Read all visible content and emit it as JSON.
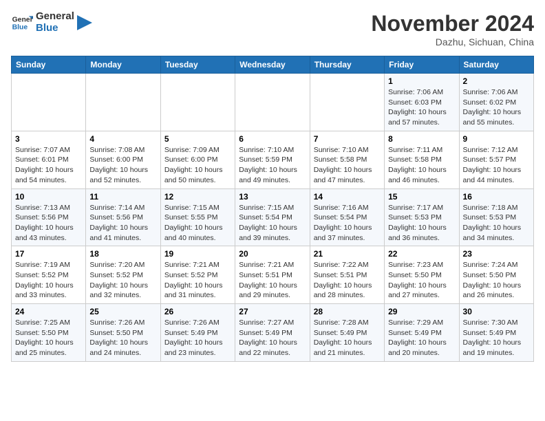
{
  "header": {
    "logo_line1": "General",
    "logo_line2": "Blue",
    "month": "November 2024",
    "location": "Dazhu, Sichuan, China"
  },
  "weekdays": [
    "Sunday",
    "Monday",
    "Tuesday",
    "Wednesday",
    "Thursday",
    "Friday",
    "Saturday"
  ],
  "weeks": [
    [
      {
        "day": "",
        "info": ""
      },
      {
        "day": "",
        "info": ""
      },
      {
        "day": "",
        "info": ""
      },
      {
        "day": "",
        "info": ""
      },
      {
        "day": "",
        "info": ""
      },
      {
        "day": "1",
        "info": "Sunrise: 7:06 AM\nSunset: 6:03 PM\nDaylight: 10 hours and 57 minutes."
      },
      {
        "day": "2",
        "info": "Sunrise: 7:06 AM\nSunset: 6:02 PM\nDaylight: 10 hours and 55 minutes."
      }
    ],
    [
      {
        "day": "3",
        "info": "Sunrise: 7:07 AM\nSunset: 6:01 PM\nDaylight: 10 hours and 54 minutes."
      },
      {
        "day": "4",
        "info": "Sunrise: 7:08 AM\nSunset: 6:00 PM\nDaylight: 10 hours and 52 minutes."
      },
      {
        "day": "5",
        "info": "Sunrise: 7:09 AM\nSunset: 6:00 PM\nDaylight: 10 hours and 50 minutes."
      },
      {
        "day": "6",
        "info": "Sunrise: 7:10 AM\nSunset: 5:59 PM\nDaylight: 10 hours and 49 minutes."
      },
      {
        "day": "7",
        "info": "Sunrise: 7:10 AM\nSunset: 5:58 PM\nDaylight: 10 hours and 47 minutes."
      },
      {
        "day": "8",
        "info": "Sunrise: 7:11 AM\nSunset: 5:58 PM\nDaylight: 10 hours and 46 minutes."
      },
      {
        "day": "9",
        "info": "Sunrise: 7:12 AM\nSunset: 5:57 PM\nDaylight: 10 hours and 44 minutes."
      }
    ],
    [
      {
        "day": "10",
        "info": "Sunrise: 7:13 AM\nSunset: 5:56 PM\nDaylight: 10 hours and 43 minutes."
      },
      {
        "day": "11",
        "info": "Sunrise: 7:14 AM\nSunset: 5:56 PM\nDaylight: 10 hours and 41 minutes."
      },
      {
        "day": "12",
        "info": "Sunrise: 7:15 AM\nSunset: 5:55 PM\nDaylight: 10 hours and 40 minutes."
      },
      {
        "day": "13",
        "info": "Sunrise: 7:15 AM\nSunset: 5:54 PM\nDaylight: 10 hours and 39 minutes."
      },
      {
        "day": "14",
        "info": "Sunrise: 7:16 AM\nSunset: 5:54 PM\nDaylight: 10 hours and 37 minutes."
      },
      {
        "day": "15",
        "info": "Sunrise: 7:17 AM\nSunset: 5:53 PM\nDaylight: 10 hours and 36 minutes."
      },
      {
        "day": "16",
        "info": "Sunrise: 7:18 AM\nSunset: 5:53 PM\nDaylight: 10 hours and 34 minutes."
      }
    ],
    [
      {
        "day": "17",
        "info": "Sunrise: 7:19 AM\nSunset: 5:52 PM\nDaylight: 10 hours and 33 minutes."
      },
      {
        "day": "18",
        "info": "Sunrise: 7:20 AM\nSunset: 5:52 PM\nDaylight: 10 hours and 32 minutes."
      },
      {
        "day": "19",
        "info": "Sunrise: 7:21 AM\nSunset: 5:52 PM\nDaylight: 10 hours and 31 minutes."
      },
      {
        "day": "20",
        "info": "Sunrise: 7:21 AM\nSunset: 5:51 PM\nDaylight: 10 hours and 29 minutes."
      },
      {
        "day": "21",
        "info": "Sunrise: 7:22 AM\nSunset: 5:51 PM\nDaylight: 10 hours and 28 minutes."
      },
      {
        "day": "22",
        "info": "Sunrise: 7:23 AM\nSunset: 5:50 PM\nDaylight: 10 hours and 27 minutes."
      },
      {
        "day": "23",
        "info": "Sunrise: 7:24 AM\nSunset: 5:50 PM\nDaylight: 10 hours and 26 minutes."
      }
    ],
    [
      {
        "day": "24",
        "info": "Sunrise: 7:25 AM\nSunset: 5:50 PM\nDaylight: 10 hours and 25 minutes."
      },
      {
        "day": "25",
        "info": "Sunrise: 7:26 AM\nSunset: 5:50 PM\nDaylight: 10 hours and 24 minutes."
      },
      {
        "day": "26",
        "info": "Sunrise: 7:26 AM\nSunset: 5:49 PM\nDaylight: 10 hours and 23 minutes."
      },
      {
        "day": "27",
        "info": "Sunrise: 7:27 AM\nSunset: 5:49 PM\nDaylight: 10 hours and 22 minutes."
      },
      {
        "day": "28",
        "info": "Sunrise: 7:28 AM\nSunset: 5:49 PM\nDaylight: 10 hours and 21 minutes."
      },
      {
        "day": "29",
        "info": "Sunrise: 7:29 AM\nSunset: 5:49 PM\nDaylight: 10 hours and 20 minutes."
      },
      {
        "day": "30",
        "info": "Sunrise: 7:30 AM\nSunset: 5:49 PM\nDaylight: 10 hours and 19 minutes."
      }
    ]
  ]
}
